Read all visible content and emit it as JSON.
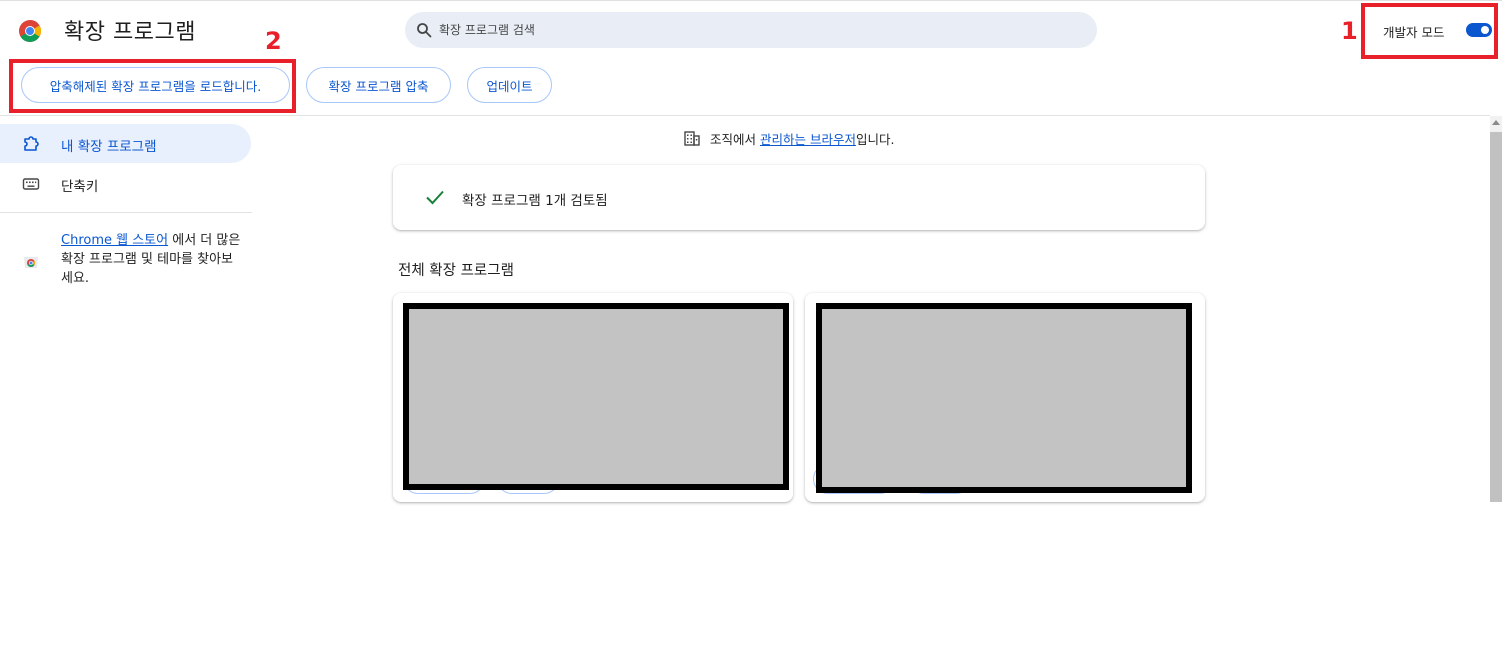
{
  "header": {
    "title": "확장 프로그램",
    "search_placeholder": "확장 프로그램 검색",
    "dev_mode_label": "개발자 모드",
    "dev_mode_on": true
  },
  "toolbar": {
    "load_unpacked": "압축해제된 확장 프로그램을 로드합니다.",
    "pack": "확장 프로그램 압축",
    "update": "업데이트"
  },
  "sidebar": {
    "items": [
      {
        "label": "내 확장 프로그램",
        "icon": "puzzle-icon",
        "active": true
      },
      {
        "label": "단축키",
        "icon": "keyboard-icon",
        "active": false
      }
    ],
    "store_link": "Chrome 웹 스토어",
    "store_text_after": " 에서 더 많은 확장 프로그램 및 테마를 찾아보세요."
  },
  "main": {
    "managed_prefix": "조직에서 ",
    "managed_link": "관리하는 브라우저",
    "managed_suffix": "입니다.",
    "review_text": "확장 프로그램 1개 검토됨",
    "section_title": "전체 확장 프로그램"
  },
  "annotations": {
    "label_1": "1",
    "label_2": "2",
    "color": "#e8202a"
  },
  "colors": {
    "accent": "#0b57d0",
    "sidebar_active_bg": "#e8effd",
    "search_bg": "#e9eef6",
    "check": "#188038"
  }
}
